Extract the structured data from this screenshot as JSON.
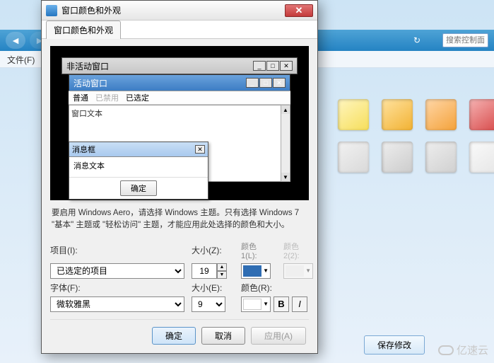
{
  "toolbar": {
    "search_placeholder": "搜索控制面板"
  },
  "menubar": {
    "file": "文件(F)"
  },
  "dialog": {
    "title": "窗口颜色和外观",
    "tab": "窗口颜色和外观",
    "note": "要启用 Windows Aero，请选择 Windows 主题。只有选择 Windows 7 \"基本\" 主题或 \"轻松访问\" 主题，才能应用此处选择的颜色和大小。",
    "item_label": "项目(I):",
    "item_value": "已选定的项目",
    "size_label": "大小(Z):",
    "size_value": "19",
    "color1_header": "颜色",
    "color1_label": "1(L):",
    "color2_header": "颜色",
    "color2_label": "2(2):",
    "font_label": "字体(F):",
    "font_value": "微软雅黑",
    "fsize_label": "大小(E):",
    "fsize_value": "9",
    "fcolor_label": "颜色(R):",
    "ok": "确定",
    "cancel": "取消",
    "apply": "应用(A)",
    "colors": {
      "c1": "#2f6db3",
      "fc": "#ffffff"
    }
  },
  "preview": {
    "inactive": "非活动窗口",
    "active": "活动窗口",
    "menu_normal": "普通",
    "menu_disabled": "已禁用",
    "menu_selected": "已选定",
    "window_text": "窗口文本",
    "msg_title": "消息框",
    "msg_text": "消息文本",
    "msg_ok": "确定"
  },
  "swatches": {
    "row1": [
      "#f6de5a",
      "#f2b233",
      "#f4a23a",
      "#d64848"
    ],
    "row2": [
      "#d9d9d9",
      "#cccccc",
      "#d0d0d0",
      "#e6e6e6"
    ]
  },
  "footer": {
    "save": "保存修改"
  },
  "watermark": "亿速云"
}
